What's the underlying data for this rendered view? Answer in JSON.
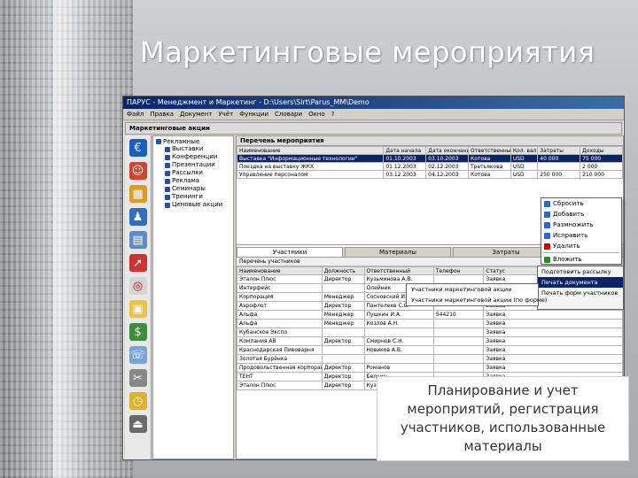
{
  "slide": {
    "title": "Маркетинговые мероприятия",
    "caption_lines": [
      "Планирование и учет",
      "мероприятий, регистрация",
      "участников, использованные",
      "материалы"
    ]
  },
  "window": {
    "title": "ПАРУС - Менеджмент и Маркетинг - D:\\Users\\Sirt\\Parus_MM\\Demo",
    "menu": [
      "Файл",
      "Правка",
      "Документ",
      "Учёт",
      "Функции",
      "Словари",
      "Окно",
      "?"
    ],
    "nav_title": "Маркетинговые акции",
    "panel_title": "Перечень мероприятия"
  },
  "tree": {
    "root": "Рекламные",
    "items": [
      "Выставки",
      "Конференции",
      "Презентации",
      "Рассылки",
      "Реклама",
      "Семинары",
      "Тренинги",
      "Ценовые акции"
    ]
  },
  "events_table": {
    "columns": [
      "Наименование",
      "Дата начала",
      "Дата окончания",
      "Ответственный",
      "Кол. валюты",
      "Затраты",
      "Доходы"
    ],
    "rows": [
      [
        "Выставка \"Информационные технологии\"",
        "01.10.2003",
        "03.10.2003",
        "Котова",
        "USD",
        "40 000",
        "75 000"
      ],
      [
        "Поездка на выставку ЖКХ",
        "01.12.2003",
        "02.12.2003",
        "Третьякова",
        "USD",
        "",
        "2 000"
      ],
      [
        "Управление персоналом",
        "03.12.2003",
        "04.12.2003",
        "Котова",
        "USD",
        "250 000",
        "210 000"
      ]
    ]
  },
  "lower_tabs": [
    "Участники",
    "Материалы",
    "Затраты"
  ],
  "participants": {
    "subtitle": "Перечень участников",
    "columns": [
      "Наименование",
      "Должность",
      "Ответственный",
      "Телефон",
      "Статус"
    ],
    "rows": [
      [
        "Эталон Плюс",
        "Директор",
        "Кузьминова А.В.",
        "",
        "Заявка"
      ],
      [
        "Интерфейс",
        "",
        "Олейник",
        "",
        "Заявка"
      ],
      [
        "Корпорация",
        "Менеджер",
        "Сосновский И.В.",
        "",
        "Заявка"
      ],
      [
        "Аэрофлот",
        "Директор",
        "Пантелеев С.С.",
        "",
        "Заявка"
      ],
      [
        "Альфа",
        "Менеджер",
        "Пушкин И.А.",
        "544210",
        "Заявка"
      ],
      [
        "Альфа",
        "Менеджер",
        "Козлов А.Н.",
        "",
        "Заявка"
      ],
      [
        "Кубанское Экспо",
        "",
        "",
        "",
        "Заявка"
      ],
      [
        "Компания АВ",
        "Директор",
        "Смирнов С.Н.",
        "",
        "Заявка"
      ],
      [
        "Краснодарская Пивоварня",
        "",
        "Новиков А.В.",
        "",
        "Заявка"
      ],
      [
        "Золотая Бурёнка",
        "",
        "",
        "",
        "Заявка"
      ],
      [
        "Продовольственная корпорация",
        "Директор",
        "Романов",
        "",
        "Заявка"
      ],
      [
        "ТЕНТ",
        "Директор",
        "Белкин",
        "",
        "Заявка"
      ],
      [
        "Эталон Плюс",
        "Директор",
        "Кузьминова",
        "",
        "Заявка"
      ]
    ]
  },
  "context_menu": [
    "Сбросить",
    "Добавить",
    "Размножить",
    "Исправить",
    "Удалить",
    "Вложить"
  ],
  "popup_menu": [
    "Подготовить рассылку",
    "Печать документа",
    "Печать форм участников"
  ],
  "submenu": [
    "Участники маркетинговой акции",
    "Участники маркетинговой акции (по форме)"
  ]
}
